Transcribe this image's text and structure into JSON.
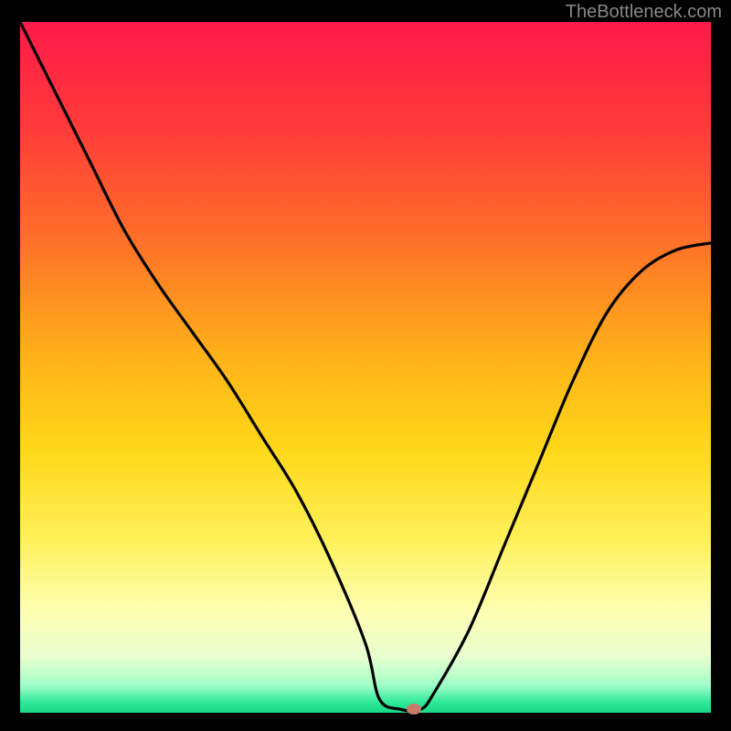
{
  "watermark": "TheBottleneck.com",
  "chart_data": {
    "type": "line",
    "title": "",
    "xlabel": "",
    "ylabel": "",
    "xlim": [
      0,
      100
    ],
    "ylim": [
      0,
      100
    ],
    "gradient": {
      "stops": [
        {
          "offset": 0,
          "color": "#ff1a4a"
        },
        {
          "offset": 15,
          "color": "#ff3a3a"
        },
        {
          "offset": 30,
          "color": "#ff6a2a"
        },
        {
          "offset": 48,
          "color": "#ffb01a"
        },
        {
          "offset": 62,
          "color": "#ffd81a"
        },
        {
          "offset": 75,
          "color": "#fff05a"
        },
        {
          "offset": 85,
          "color": "#ffffb0"
        },
        {
          "offset": 92,
          "color": "#e8ffd0"
        },
        {
          "offset": 96,
          "color": "#a0ffc8"
        },
        {
          "offset": 98.5,
          "color": "#30e89a"
        },
        {
          "offset": 100,
          "color": "#18d888"
        }
      ]
    },
    "series": [
      {
        "name": "bottleneck-curve",
        "x": [
          0,
          5,
          10,
          15,
          20,
          25,
          30,
          35,
          40,
          45,
          50,
          52,
          55,
          58,
          60,
          65,
          70,
          75,
          80,
          85,
          90,
          95,
          100
        ],
        "y": [
          100,
          90,
          80,
          70,
          62,
          55,
          48,
          40,
          32,
          22,
          10,
          2,
          0.5,
          0.5,
          3,
          12,
          24,
          36,
          48,
          58,
          64,
          67,
          68
        ]
      }
    ],
    "marker": {
      "x": 57,
      "y": 0.5,
      "color": "#c77a6a"
    }
  }
}
